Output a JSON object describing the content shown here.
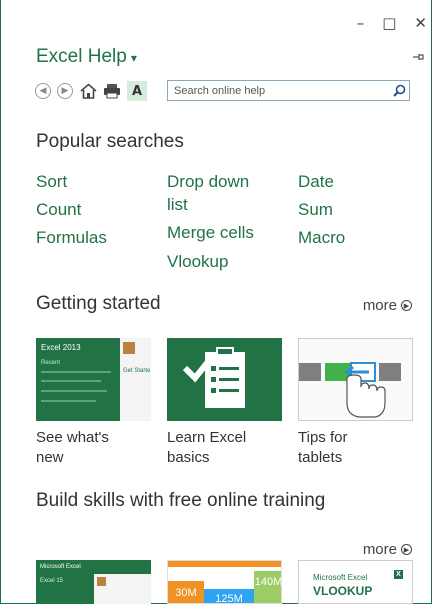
{
  "window": {
    "minimize": "–",
    "maximize": "□",
    "close": "✕"
  },
  "header": {
    "title": "Excel Help",
    "caret": "▾"
  },
  "toolbar": {
    "font_label": "A"
  },
  "search": {
    "placeholder": "Search online help"
  },
  "popular": {
    "heading": "Popular searches",
    "col1": [
      "Sort",
      "Count",
      "Formulas"
    ],
    "col2": [
      "Drop down",
      "list",
      "Merge cells",
      "Vlookup"
    ],
    "col3": [
      "Date",
      "Sum",
      "Macro"
    ]
  },
  "getting_started": {
    "heading": "Getting started",
    "more": "more",
    "tiles": [
      {
        "line1": "See what's",
        "line2": "new",
        "thumb_title": "Excel 2013",
        "thumb_recent": "Recent",
        "thumb_get": "Get Starte"
      },
      {
        "line1": "Learn Excel",
        "line2": "basics"
      },
      {
        "line1": "Tips for",
        "line2": "tablets"
      }
    ]
  },
  "training": {
    "heading": "Build skills with free online training",
    "more": "more",
    "tiles": [
      {
        "label": "Microsoft Excel",
        "sub": "Excel 15"
      },
      {
        "label": "30M",
        "label2": "125M",
        "label3": "140M"
      },
      {
        "label": "Microsoft Excel",
        "sub": "VLOOKUP"
      }
    ]
  },
  "colors": {
    "accent": "#217346",
    "tile_bg": "#217346"
  }
}
